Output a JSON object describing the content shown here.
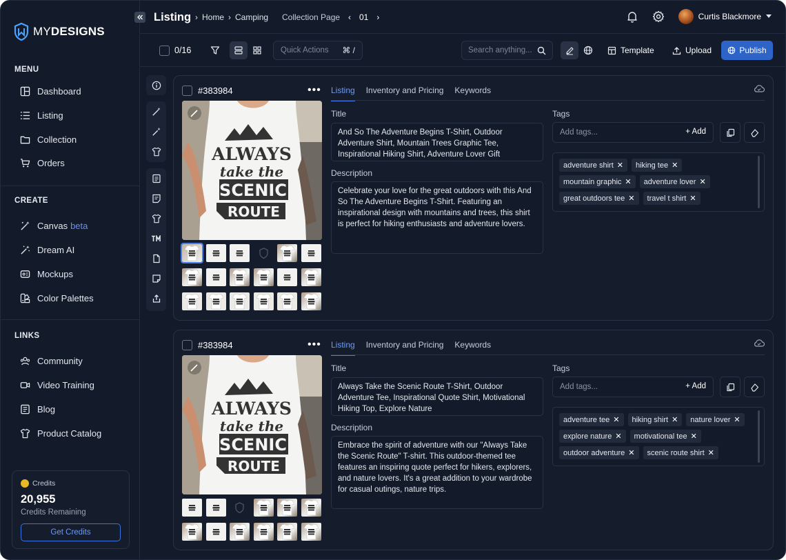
{
  "brand": {
    "name_light": "MY",
    "name_bold": "DESIGNS"
  },
  "sidebar": {
    "menu_title": "MENU",
    "menu": [
      {
        "label": "Dashboard",
        "icon": "dashboard-icon"
      },
      {
        "label": "Listing",
        "icon": "list-icon"
      },
      {
        "label": "Collection",
        "icon": "folder-icon"
      },
      {
        "label": "Orders",
        "icon": "cart-icon"
      }
    ],
    "create_title": "CREATE",
    "create": [
      {
        "label": "Canvas",
        "badge": "beta",
        "icon": "magic-wand-icon"
      },
      {
        "label": "Dream AI",
        "icon": "sparkle-wand-icon"
      },
      {
        "label": "Mockups",
        "icon": "mockup-icon"
      },
      {
        "label": "Color Palettes",
        "icon": "palette-icon"
      }
    ],
    "links_title": "LINKS",
    "links": [
      {
        "label": "Community",
        "icon": "community-icon"
      },
      {
        "label": "Video Training",
        "icon": "video-icon"
      },
      {
        "label": "Blog",
        "icon": "blog-icon"
      },
      {
        "label": "Product Catalog",
        "icon": "tshirt-icon"
      }
    ],
    "credits": {
      "label": "Credits",
      "amount": "20,955",
      "sub": "Credits Remaining",
      "button": "Get Credits"
    }
  },
  "header": {
    "title": "Listing",
    "breadcrumb": [
      "Home",
      "Camping"
    ],
    "collection_page": "Collection Page",
    "page_number": "01",
    "user": "Curtis Blackmore"
  },
  "toolbar": {
    "selection": "0/16",
    "quick_actions": "Quick Actions",
    "shortcut": "⌘ /",
    "search_placeholder": "Search anything...",
    "template": "Template",
    "upload": "Upload",
    "publish": "Publish"
  },
  "listings": [
    {
      "id": "#383984",
      "tabs": [
        "Listing",
        "Inventory and Pricing",
        "Keywords"
      ],
      "title_label": "Title",
      "title": "And So The Adventure Begins T-Shirt, Outdoor Adventure Shirt, Mountain Trees Graphic Tee, Inspirational Hiking Shirt, Adventure Lover Gift",
      "description_label": "Description",
      "description": "Celebrate your love for the great outdoors with this And So The Adventure Begins T-Shirt. Featuring an inspirational design with mountains and trees, this shirt is perfect for hiking enthusiasts and adventure lovers.",
      "tags_label": "Tags",
      "tags_placeholder": "Add tags...",
      "add_label": "+ Add",
      "tags": [
        [
          "adventure shirt",
          "hiking tee"
        ],
        [
          "mountain graphic",
          "adventure lover"
        ],
        [
          "great outdoors tee",
          "travel t shirt"
        ]
      ],
      "print": {
        "line1": "ALWAYS",
        "line2": "take the",
        "line3": "SCENIC",
        "line4": "ROUTE"
      }
    },
    {
      "id": "#383984",
      "tabs": [
        "Listing",
        "Inventory and Pricing",
        "Keywords"
      ],
      "title_label": "Title",
      "title": "Always Take the Scenic Route T-Shirt, Outdoor Adventure Tee, Inspirational Quote Shirt, Motivational Hiking Top, Explore Nature",
      "description_label": "Description",
      "description": "Embrace the spirit of adventure with our \"Always Take the Scenic Route\" T-shirt. This outdoor-themed tee features an inspiring quote perfect for hikers, explorers, and nature lovers. It's a great addition to your wardrobe for casual outings, nature trips.",
      "tags_label": "Tags",
      "tags_placeholder": "Add tags...",
      "add_label": "+ Add",
      "tags": [
        [
          "adventure tee",
          "hiking shirt",
          "nature lover"
        ],
        [
          "explore nature",
          "motivational tee"
        ],
        [
          "outdoor adventure",
          "scenic route shirt"
        ]
      ],
      "print": {
        "line1": "ALWAYS",
        "line2": "take the",
        "line3": "SCENIC",
        "line4": "ROUTE"
      }
    }
  ]
}
